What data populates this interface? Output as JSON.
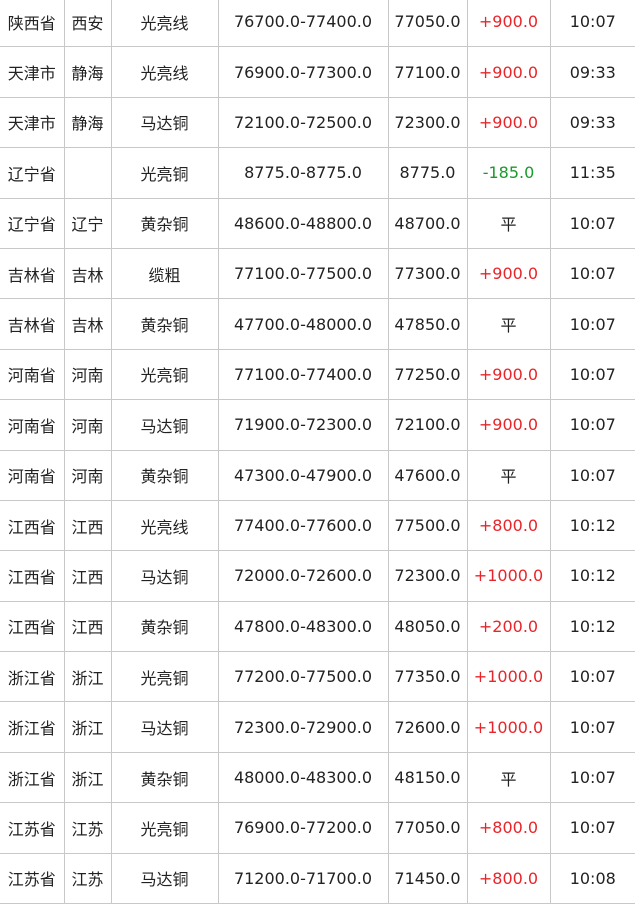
{
  "colors": {
    "up": "#e8252a",
    "down": "#1a9a2a",
    "flat": "#222222",
    "grid": "#c8c8c8"
  },
  "rows": [
    {
      "province": "陕西省",
      "city": "西安",
      "type": "光亮线",
      "range": "76700.0-77400.0",
      "avg": "77050.0",
      "change": "+900.0",
      "time": "10:07"
    },
    {
      "province": "天津市",
      "city": "静海",
      "type": "光亮线",
      "range": "76900.0-77300.0",
      "avg": "77100.0",
      "change": "+900.0",
      "time": "09:33"
    },
    {
      "province": "天津市",
      "city": "静海",
      "type": "马达铜",
      "range": "72100.0-72500.0",
      "avg": "72300.0",
      "change": "+900.0",
      "time": "09:33"
    },
    {
      "province": "辽宁省",
      "city": "",
      "type": "光亮铜",
      "range": "8775.0-8775.0",
      "avg": "8775.0",
      "change": "-185.0",
      "time": "11:35"
    },
    {
      "province": "辽宁省",
      "city": "辽宁",
      "type": "黄杂铜",
      "range": "48600.0-48800.0",
      "avg": "48700.0",
      "change": "平",
      "time": "10:07"
    },
    {
      "province": "吉林省",
      "city": "吉林",
      "type": "缆粗",
      "range": "77100.0-77500.0",
      "avg": "77300.0",
      "change": "+900.0",
      "time": "10:07"
    },
    {
      "province": "吉林省",
      "city": "吉林",
      "type": "黄杂铜",
      "range": "47700.0-48000.0",
      "avg": "47850.0",
      "change": "平",
      "time": "10:07"
    },
    {
      "province": "河南省",
      "city": "河南",
      "type": "光亮铜",
      "range": "77100.0-77400.0",
      "avg": "77250.0",
      "change": "+900.0",
      "time": "10:07"
    },
    {
      "province": "河南省",
      "city": "河南",
      "type": "马达铜",
      "range": "71900.0-72300.0",
      "avg": "72100.0",
      "change": "+900.0",
      "time": "10:07"
    },
    {
      "province": "河南省",
      "city": "河南",
      "type": "黄杂铜",
      "range": "47300.0-47900.0",
      "avg": "47600.0",
      "change": "平",
      "time": "10:07"
    },
    {
      "province": "江西省",
      "city": "江西",
      "type": "光亮线",
      "range": "77400.0-77600.0",
      "avg": "77500.0",
      "change": "+800.0",
      "time": "10:12"
    },
    {
      "province": "江西省",
      "city": "江西",
      "type": "马达铜",
      "range": "72000.0-72600.0",
      "avg": "72300.0",
      "change": "+1000.0",
      "time": "10:12"
    },
    {
      "province": "江西省",
      "city": "江西",
      "type": "黄杂铜",
      "range": "47800.0-48300.0",
      "avg": "48050.0",
      "change": "+200.0",
      "time": "10:12"
    },
    {
      "province": "浙江省",
      "city": "浙江",
      "type": "光亮铜",
      "range": "77200.0-77500.0",
      "avg": "77350.0",
      "change": "+1000.0",
      "time": "10:07"
    },
    {
      "province": "浙江省",
      "city": "浙江",
      "type": "马达铜",
      "range": "72300.0-72900.0",
      "avg": "72600.0",
      "change": "+1000.0",
      "time": "10:07"
    },
    {
      "province": "浙江省",
      "city": "浙江",
      "type": "黄杂铜",
      "range": "48000.0-48300.0",
      "avg": "48150.0",
      "change": "平",
      "time": "10:07"
    },
    {
      "province": "江苏省",
      "city": "江苏",
      "type": "光亮铜",
      "range": "76900.0-77200.0",
      "avg": "77050.0",
      "change": "+800.0",
      "time": "10:07"
    },
    {
      "province": "江苏省",
      "city": "江苏",
      "type": "马达铜",
      "range": "71200.0-71700.0",
      "avg": "71450.0",
      "change": "+800.0",
      "time": "10:08"
    }
  ]
}
